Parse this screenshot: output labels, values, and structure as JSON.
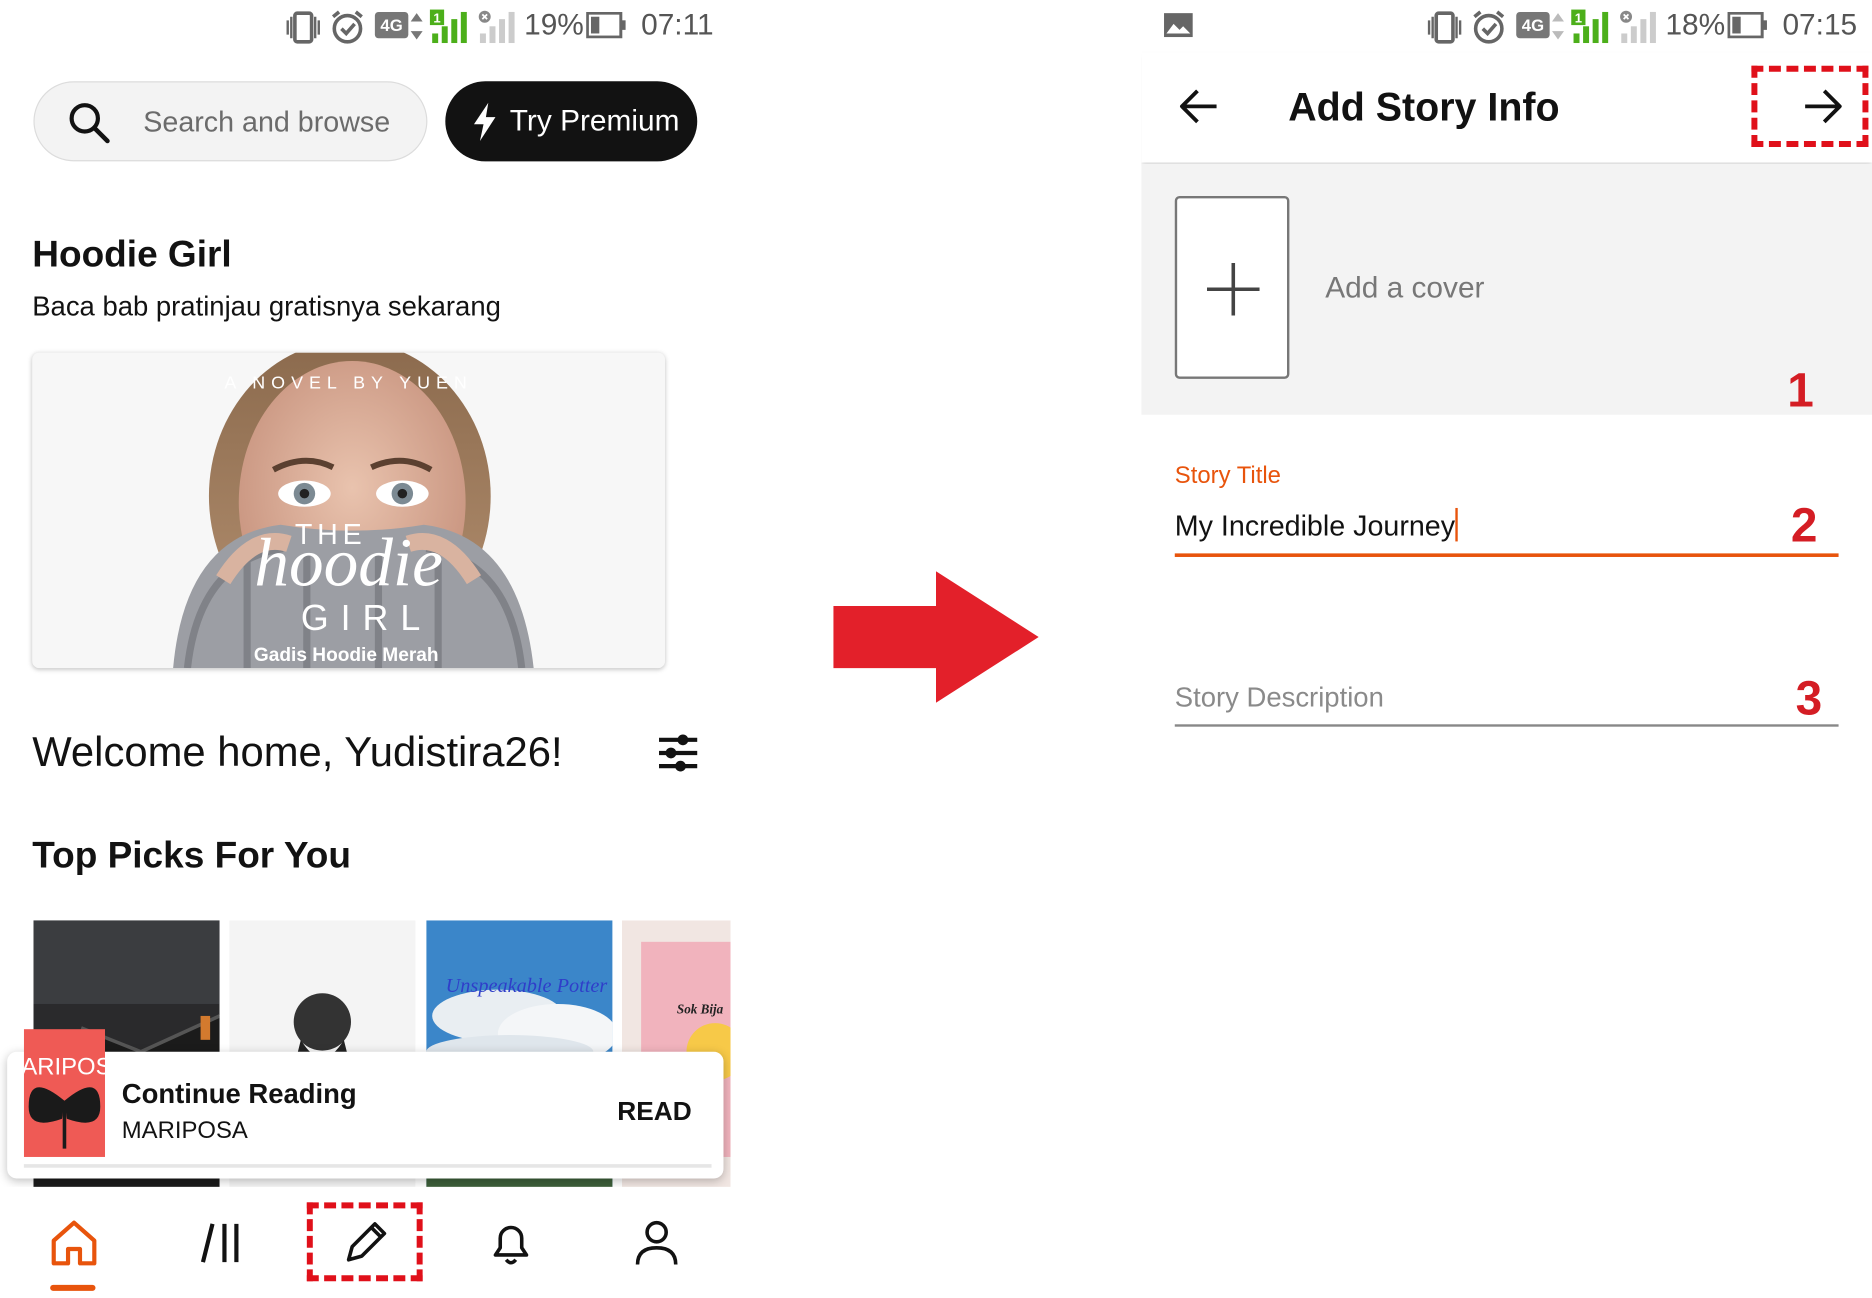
{
  "left_screen": {
    "status_bar": {
      "network": "4G",
      "battery": "19%",
      "time": "07:11",
      "sim_badge": "1"
    },
    "search": {
      "placeholder": "Search and browse"
    },
    "premium_button": {
      "label": "Try Premium"
    },
    "featured": {
      "title": "Hoodie Girl",
      "subtitle": "Baca bab pratinjau gratisnya sekarang",
      "banner_top_text": "A NOVEL BY YUEN",
      "banner_title_the": "THE",
      "banner_title_script": "hoodie",
      "banner_title_girl": "GIRL",
      "banner_caption": "Gadis Hoodie Merah"
    },
    "welcome": "Welcome home, Yudistira26!",
    "top_picks": {
      "heading": "Top Picks For You",
      "covers": [
        {
          "text": ""
        },
        {
          "text": ""
        },
        {
          "text": "Unspeakable Potter"
        },
        {
          "text": "Sok Bija"
        }
      ]
    },
    "continue_reading": {
      "label": "Continue Reading",
      "book": "MARIPOSA",
      "cover_text": "MARIPOSA",
      "action": "READ"
    },
    "bottom_nav": [
      "home",
      "library",
      "write",
      "notifications",
      "profile"
    ]
  },
  "right_screen": {
    "status_bar": {
      "network": "4G",
      "battery": "18%",
      "time": "07:15",
      "sim_badge": "1"
    },
    "header": {
      "title": "Add Story Info"
    },
    "cover": {
      "label": "Add a cover"
    },
    "title_field": {
      "label": "Story Title",
      "value": "My Incredible Journey"
    },
    "description_field": {
      "placeholder": "Story Description"
    },
    "step_numbers": [
      "1",
      "2",
      "3"
    ]
  },
  "colors": {
    "accent": "#e8540c",
    "highlight": "#e0101a",
    "arrow": "#e3202a",
    "dark": "#121212"
  }
}
